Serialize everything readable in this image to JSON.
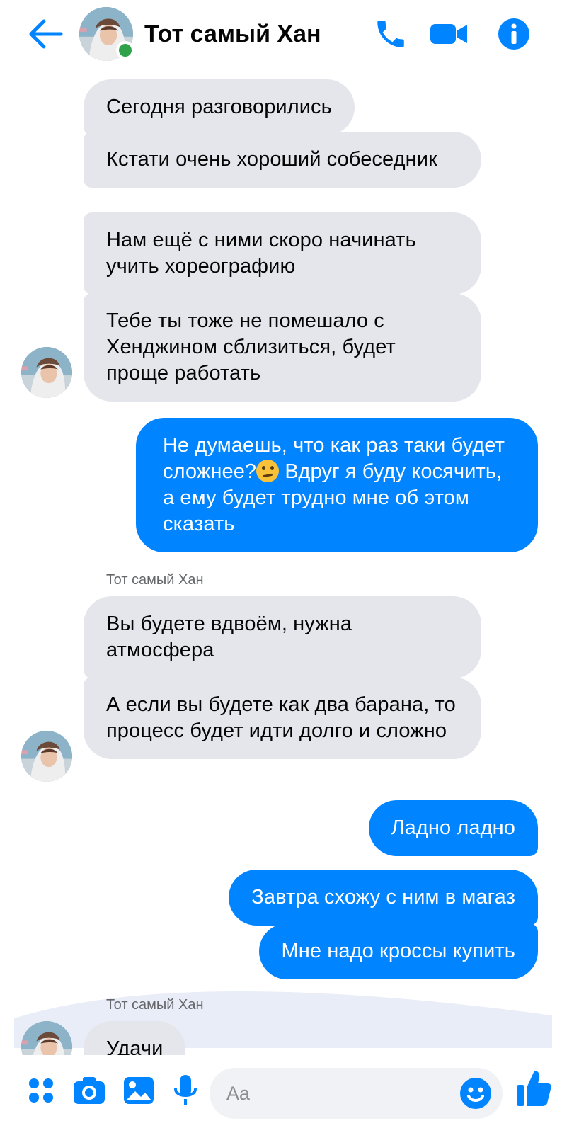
{
  "header": {
    "contact_name": "Тот самый Хан",
    "online": true,
    "accent_color": "#0084ff",
    "icons": [
      "back-arrow-icon",
      "phone-icon",
      "video-camera-icon",
      "info-icon"
    ]
  },
  "messages": {
    "m1": "Сегодня разговорились",
    "m2": "Кстати очень хороший собеседник",
    "m3": "Нам ещё с ними скоро начинать учить хореографию",
    "m4": "Тебе ты тоже не помешало с Хенджином сблизиться, будет проще работать",
    "m5_part1": "Не думаешь, что как раз таки будет сложнее?",
    "m5_part2": " Вдруг я буду косячить, а ему будет трудно мне об этом сказать",
    "sender1": "Тот самый Хан",
    "m6": "Вы будете вдвоём, нужна атмосфера",
    "m7": "А если вы будете как два барана, то процесс будет идти долго и сложно",
    "m8": "Ладно ладно",
    "m9": "Завтра схожу с ним в магаз",
    "m10": "Мне надо кроссы купить",
    "sender2": "Тот самый Хан",
    "m11": "Удачи"
  },
  "composer": {
    "placeholder": "Aa",
    "icons": [
      "apps-icon",
      "camera-icon",
      "gallery-icon",
      "microphone-icon",
      "emoji-icon",
      "thumbs-up-icon"
    ]
  }
}
